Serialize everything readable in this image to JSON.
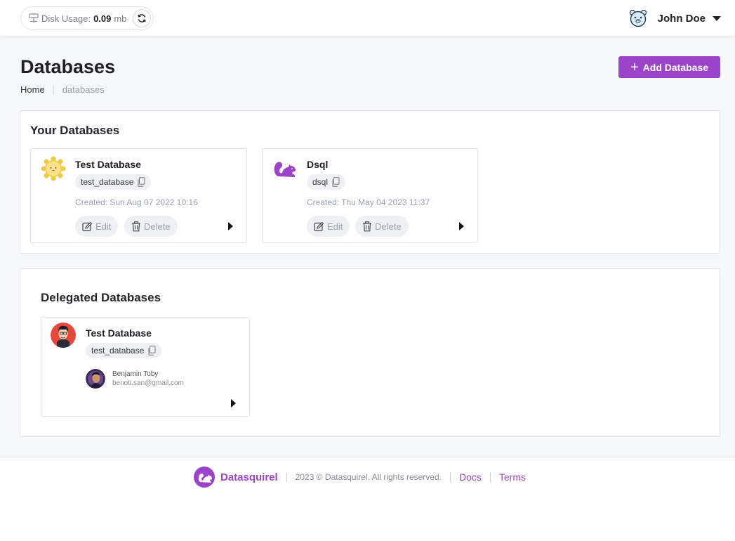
{
  "header": {
    "disk_label": "Disk Usage:",
    "disk_value": "0.09",
    "disk_unit": "mb",
    "user_name": "John Doe"
  },
  "page": {
    "title": "Databases",
    "add_button_label": "Add Database",
    "breadcrumb": {
      "home": "Home",
      "current": "databases"
    }
  },
  "your_databases": {
    "title": "Your Databases",
    "cards": [
      {
        "name": "Test Database",
        "slug": "test_database",
        "created": "Created: Sun Aug 07 2022 10:16",
        "edit_label": "Edit",
        "delete_label": "Delete"
      },
      {
        "name": "Dsql",
        "slug": "dsql",
        "created": "Created: Thu May 04 2023 11:37",
        "edit_label": "Edit",
        "delete_label": "Delete"
      }
    ]
  },
  "delegated_databases": {
    "title": "Delegated Databases",
    "cards": [
      {
        "name": "Test Database",
        "slug": "test_database",
        "owner_name": "Benjamin Toby",
        "owner_email": "benoti.san@gmail.com"
      }
    ]
  },
  "footer": {
    "brand": "Datasquirel",
    "copyright": "2023 © Datasquirel. All rights reserved.",
    "docs": "Docs",
    "terms": "Terms"
  },
  "colors": {
    "accent": "#9c44c9",
    "muted_text": "#9aa0ae",
    "pill_bg": "#eef0f4"
  }
}
